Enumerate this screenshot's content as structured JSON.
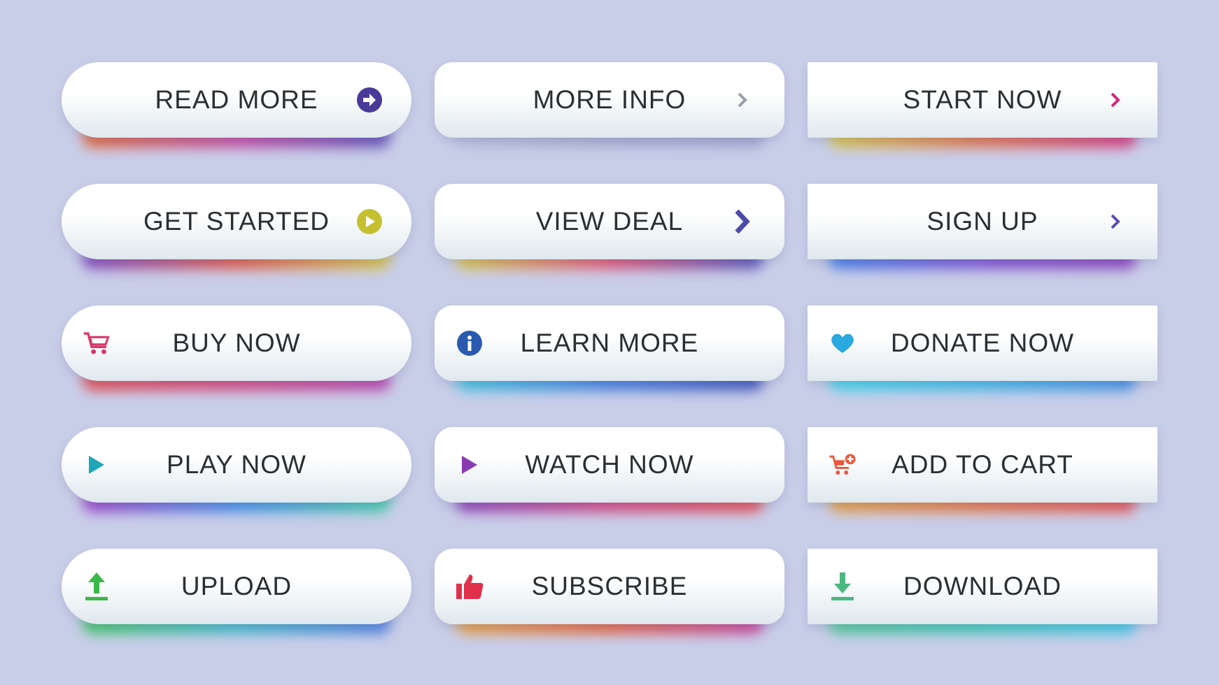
{
  "buttons": [
    {
      "label": "READ MORE",
      "icon": "arrow-circle-right-icon",
      "icon_side": "right",
      "icon_color": "#4b3a9a",
      "glow": [
        "#e8622a",
        "#c8409a",
        "#5a4ab8"
      ]
    },
    {
      "label": "MORE INFO",
      "icon": "chevron-right-icon",
      "icon_side": "right",
      "icon_color": "#9aa0a8",
      "glow": [
        "#b8bcd8",
        "#a8acd0",
        "#a0a4cc"
      ]
    },
    {
      "label": "START NOW",
      "icon": "chevron-right-icon",
      "icon_side": "right",
      "icon_color": "#d6247a",
      "glow": [
        "#d8c83a",
        "#e86a40",
        "#d8307a"
      ]
    },
    {
      "label": "GET STARTED",
      "icon": "play-circle-icon",
      "icon_side": "right",
      "icon_color": "#c6c030",
      "glow": [
        "#7a40c0",
        "#e8503a",
        "#d8c83a"
      ]
    },
    {
      "label": "VIEW DEAL",
      "icon": "chevron-right-bold-icon",
      "icon_side": "right",
      "icon_color": "#4a4aa8",
      "glow": [
        "#d8c83a",
        "#e84a6a",
        "#4a4ab8"
      ]
    },
    {
      "label": "SIGN UP",
      "icon": "chevron-right-icon",
      "icon_side": "right",
      "icon_color": "#5a4ab0",
      "glow": [
        "#3a7ae8",
        "#7a4ad0",
        "#8a3ab8"
      ]
    },
    {
      "label": "BUY NOW",
      "icon": "cart-icon",
      "icon_side": "left",
      "icon_color": "#d63a6a",
      "glow": [
        "#e84a4a",
        "#d8407a",
        "#b83aa8"
      ]
    },
    {
      "label": "LEARN MORE",
      "icon": "info-circle-icon",
      "icon_side": "left",
      "icon_color": "#2a5ab0",
      "glow": [
        "#3ac8e0",
        "#3a7ae0",
        "#3a4ab8"
      ]
    },
    {
      "label": "DONATE NOW",
      "icon": "heart-icon",
      "icon_side": "left",
      "icon_color": "#2aa8e0",
      "glow": [
        "#3ad8e8",
        "#3ab8e8",
        "#3a8ae0"
      ]
    },
    {
      "label": "PLAY NOW",
      "icon": "play-icon",
      "icon_side": "left",
      "icon_color": "#20a8b8",
      "glow": [
        "#a03ac8",
        "#3a8ae8",
        "#3ad0a0"
      ]
    },
    {
      "label": "WATCH NOW",
      "icon": "play-icon",
      "icon_side": "left",
      "icon_color": "#8a3ab0",
      "glow": [
        "#8a3ab8",
        "#d8407a",
        "#e84a4a"
      ]
    },
    {
      "label": "ADD TO CART",
      "icon": "cart-plus-icon",
      "icon_side": "left",
      "icon_color": "#e8583a",
      "glow": [
        "#e8a03a",
        "#e8703a",
        "#e84a4a"
      ]
    },
    {
      "label": "UPLOAD",
      "icon": "upload-icon",
      "icon_side": "left",
      "icon_color": "#3ab84a",
      "glow": [
        "#3ac85a",
        "#3ab8c8",
        "#4a7ae0"
      ]
    },
    {
      "label": "SUBSCRIBE",
      "icon": "thumbs-up-icon",
      "icon_side": "left",
      "icon_color": "#e0304a",
      "glow": [
        "#e8a03a",
        "#e8603a",
        "#c83a9a"
      ]
    },
    {
      "label": "DOWNLOAD",
      "icon": "download-icon",
      "icon_side": "left",
      "icon_color": "#4ab880",
      "glow": [
        "#4ac890",
        "#3ac8b8",
        "#3ac8e8"
      ]
    }
  ]
}
